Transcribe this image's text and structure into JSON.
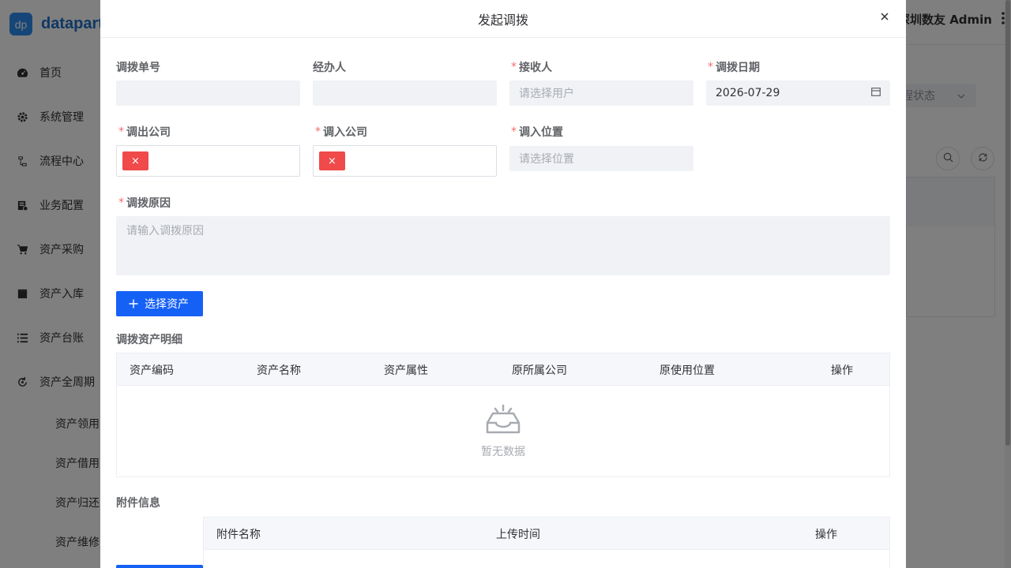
{
  "app": {
    "logo_mark": "dp",
    "logo_text": "datapart",
    "user": "深圳数友 Admin",
    "menu": [
      {
        "label": "首页",
        "icon": "dashboard-icon"
      },
      {
        "label": "系统管理",
        "icon": "gear-icon"
      },
      {
        "label": "流程中心",
        "icon": "flow-icon"
      },
      {
        "label": "业务配置",
        "icon": "config-icon"
      },
      {
        "label": "资产采购",
        "icon": "cart-icon"
      },
      {
        "label": "资产入库",
        "icon": "clapper-icon"
      },
      {
        "label": "资产台账",
        "icon": "list-icon"
      },
      {
        "label": "资产全周期",
        "icon": "cycle-icon"
      }
    ],
    "submenu": [
      "资产领用",
      "资产借用",
      "资产归还",
      "资产维修"
    ],
    "filter_placeholder": "程状态"
  },
  "dialog": {
    "title": "发起调拨",
    "fields": {
      "order_no": {
        "label": "调拨单号",
        "required": false,
        "value": ""
      },
      "handler": {
        "label": "经办人",
        "required": false,
        "value": ""
      },
      "receiver": {
        "label": "接收人",
        "required": true,
        "placeholder": "请选择用户"
      },
      "date": {
        "label": "调拨日期",
        "required": true,
        "value": "2026-07-29"
      },
      "from_company": {
        "label": "调出公司",
        "required": true,
        "tag": "×"
      },
      "to_company": {
        "label": "调入公司",
        "required": true,
        "tag": "×"
      },
      "to_location": {
        "label": "调入位置",
        "required": true,
        "placeholder": "请选择位置"
      },
      "reason": {
        "label": "调拨原因",
        "required": true,
        "placeholder": "请输入调拨原因"
      }
    },
    "select_asset_button": "选择资产",
    "asset_section": {
      "title": "调拨资产明细",
      "columns": [
        "资产编码",
        "资产名称",
        "资产属性",
        "原所属公司",
        "原使用位置",
        "操作"
      ],
      "empty_text": "暂无数据"
    },
    "attachment_section": {
      "title": "附件信息",
      "columns": [
        "附件名称",
        "上传时间",
        "操作"
      ]
    }
  }
}
